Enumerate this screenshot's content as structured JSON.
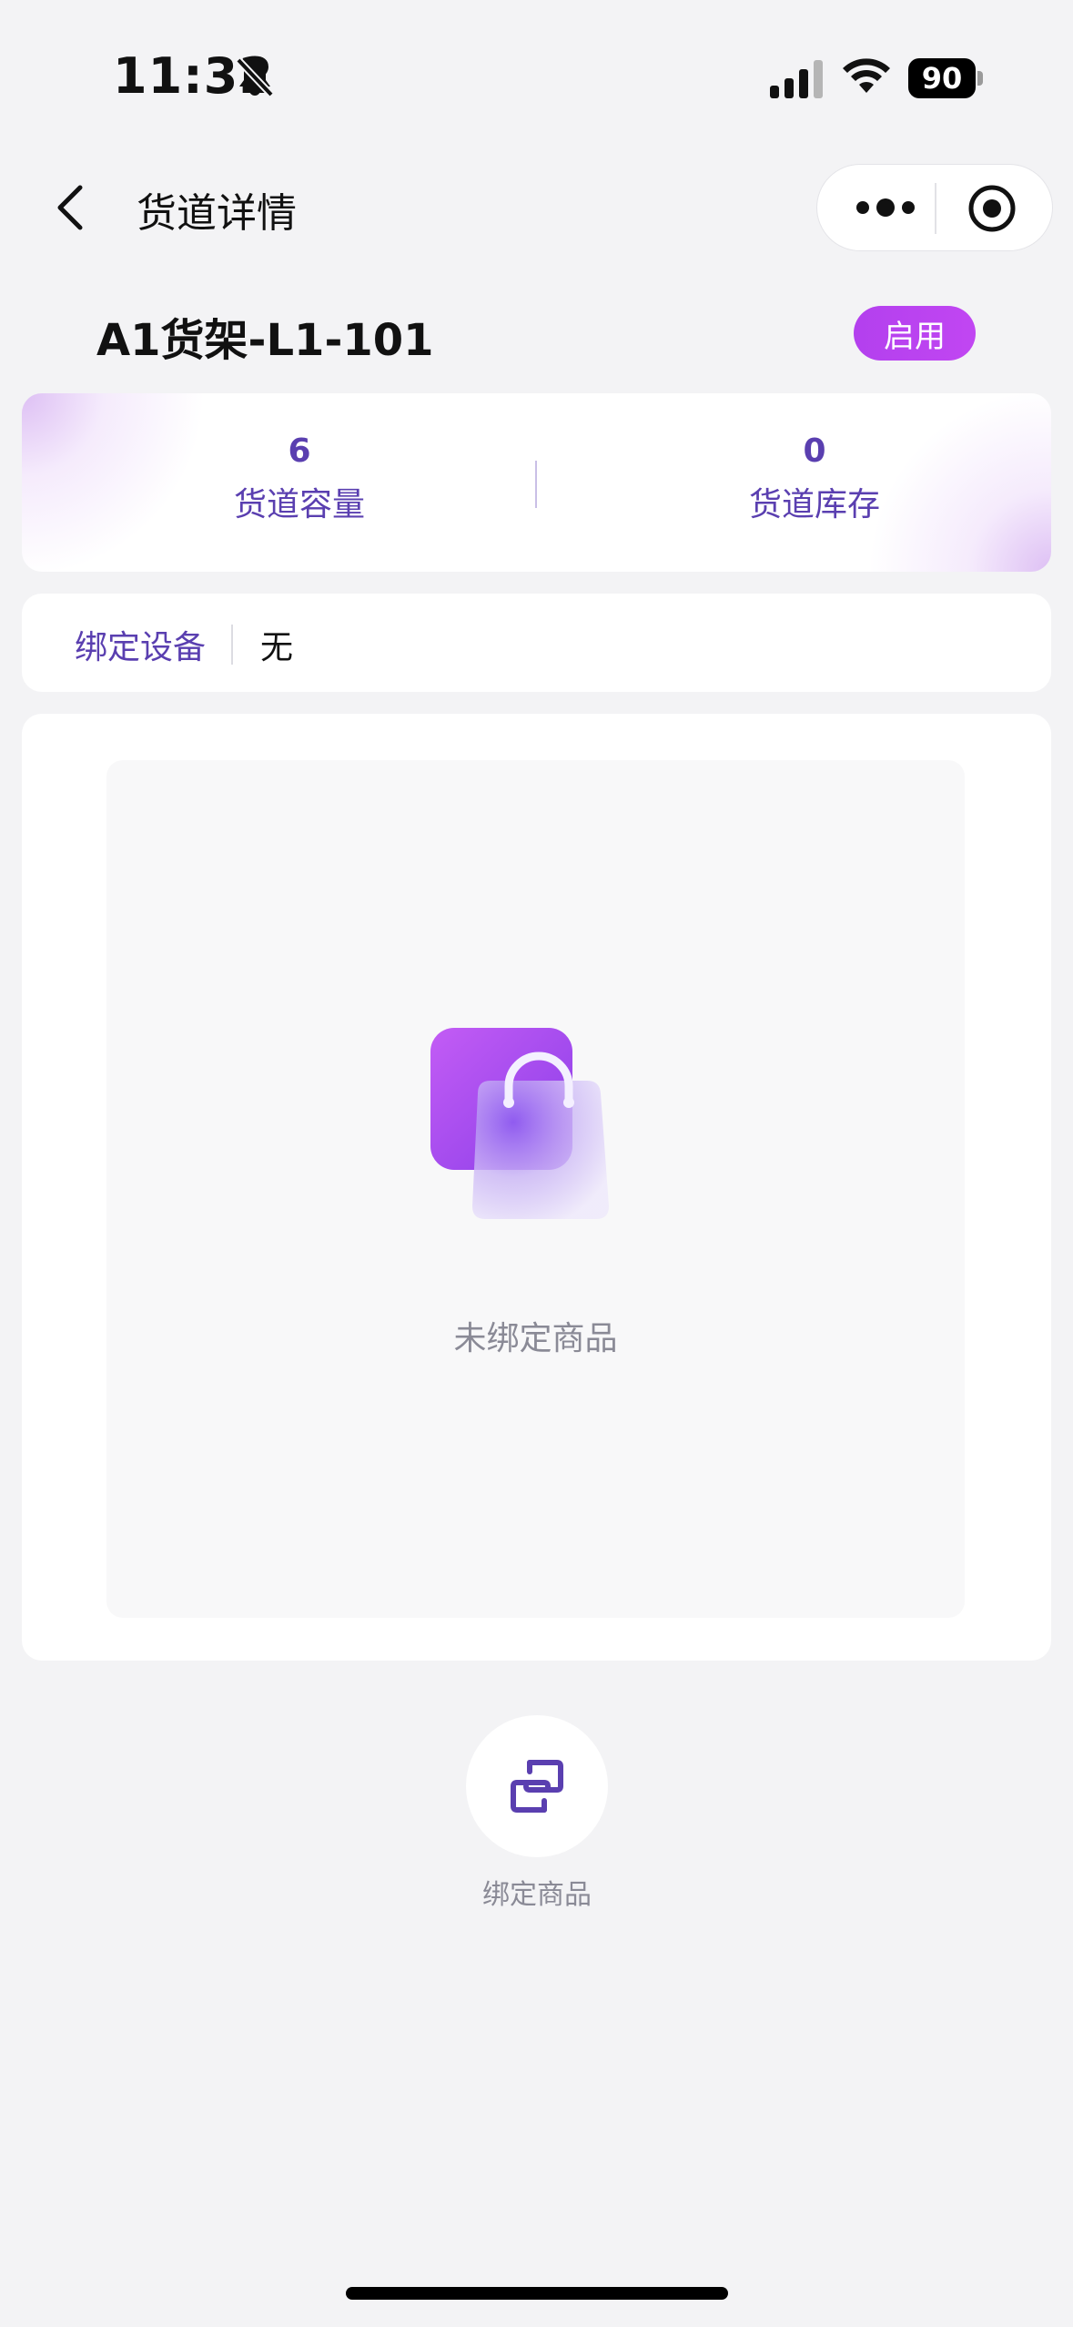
{
  "status_bar": {
    "time": "11:32",
    "battery": "90"
  },
  "nav": {
    "title": "货道详情"
  },
  "lane": {
    "name": "A1货架-L1-101",
    "status": "启用"
  },
  "stats": {
    "capacity_value": "6",
    "capacity_label": "货道容量",
    "stock_value": "0",
    "stock_label": "货道库存"
  },
  "device": {
    "label": "绑定设备",
    "value": "无"
  },
  "product": {
    "empty_text": "未绑定商品"
  },
  "actions": {
    "bind_label": "绑定商品"
  },
  "colors": {
    "accent": "#5a3fb0",
    "badge": "#bb44f0",
    "background": "#f3f3f5"
  }
}
